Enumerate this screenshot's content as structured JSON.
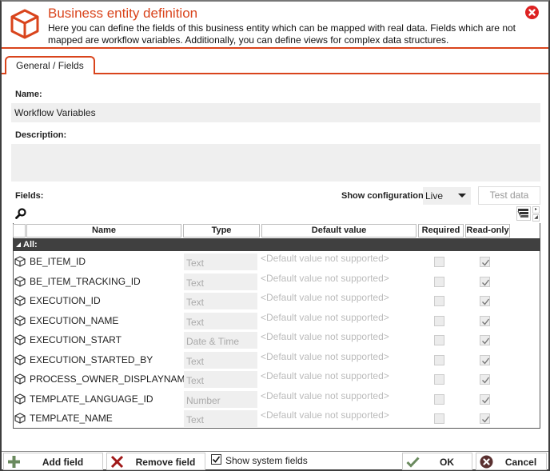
{
  "header": {
    "title": "Business entity definition",
    "description": "Here you can define the fields of this business entity which can be mapped with real data. Fields which are not mapped are workflow variables. Additionally, you can define views for complex data structures.",
    "icon": "cube-icon",
    "close_icon": "close-circle-icon"
  },
  "colors": {
    "accent": "#d9441c",
    "close": "#dd2222",
    "group_header": "#404040",
    "input_bg": "#efefef"
  },
  "tabs": [
    {
      "label": "General / Fields",
      "active": true
    }
  ],
  "form": {
    "name_label": "Name:",
    "name_value": "Workflow Variables",
    "description_label": "Description:",
    "description_value": ""
  },
  "fields_toolbar": {
    "label": "Fields:",
    "show_config_label": "Show configuration:",
    "show_config_value": "Live",
    "test_data_label": "Test data",
    "search_icon": "search-icon",
    "columns_icon": "column-chooser-icon"
  },
  "grid": {
    "columns": [
      "Name",
      "Type",
      "Default value",
      "Required",
      "Read-only"
    ],
    "group_label": "All:",
    "rows": [
      {
        "name": "BE_ITEM_ID",
        "type": "Text",
        "default": "<Default value not supported>",
        "required": false,
        "readonly": true
      },
      {
        "name": "BE_ITEM_TRACKING_ID",
        "type": "Text",
        "default": "<Default value not supported>",
        "required": false,
        "readonly": true
      },
      {
        "name": "EXECUTION_ID",
        "type": "Text",
        "default": "<Default value not supported>",
        "required": false,
        "readonly": true
      },
      {
        "name": "EXECUTION_NAME",
        "type": "Text",
        "default": "<Default value not supported>",
        "required": false,
        "readonly": true
      },
      {
        "name": "EXECUTION_START",
        "type": "Date & Time",
        "default": "<Default value not supported>",
        "required": false,
        "readonly": true
      },
      {
        "name": "EXECUTION_STARTED_BY",
        "type": "Text",
        "default": "<Default value not supported>",
        "required": false,
        "readonly": true
      },
      {
        "name": "PROCESS_OWNER_DISPLAYNAME",
        "type": "Text",
        "default": "<Default value not supported>",
        "required": false,
        "readonly": true
      },
      {
        "name": "TEMPLATE_LANGUAGE_ID",
        "type": "Number",
        "default": "<Default value not supported>",
        "required": false,
        "readonly": true
      },
      {
        "name": "TEMPLATE_NAME",
        "type": "Text",
        "default": "<Default value not supported>",
        "required": false,
        "readonly": true
      }
    ]
  },
  "footer": {
    "add_field_label": "Add field",
    "remove_field_label": "Remove field",
    "show_system_fields_label": "Show system fields",
    "show_system_fields_checked": true,
    "ok_label": "OK",
    "cancel_label": "Cancel"
  }
}
